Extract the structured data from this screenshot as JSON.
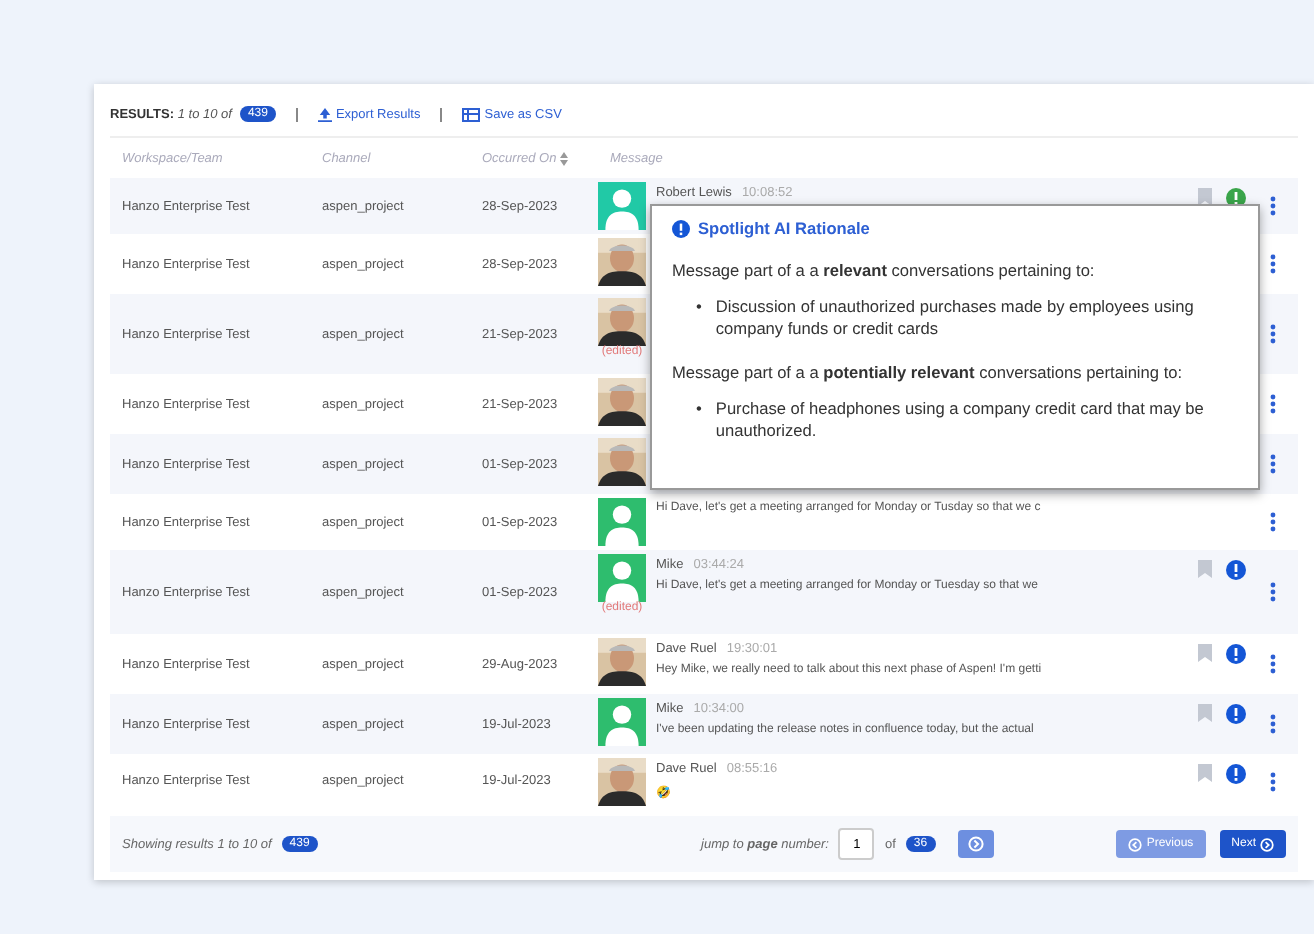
{
  "toolbar": {
    "results_label": "RESULTS:",
    "results_range": "1 to 10 of",
    "results_count": "439",
    "export": "Export Results",
    "csv": "Save as CSV"
  },
  "columns": [
    "Workspace/Team",
    "Channel",
    "Occurred On",
    "Message"
  ],
  "rows": [
    {
      "workspace": "Hanzo Enterprise Test",
      "channel": "aspen_project",
      "date": "28-Sep-2023",
      "avatar": {
        "kind": "person",
        "color": "#21c9a6"
      },
      "sender": "Robert Lewis",
      "time": "10:08:52",
      "bookmark": true,
      "flag": {
        "color": "#3aa54a"
      }
    },
    {
      "workspace": "Hanzo Enterprise Test",
      "channel": "aspen_project",
      "date": "28-Sep-2023"
    },
    {
      "workspace": "Hanzo Enterprise Test",
      "channel": "aspen_project",
      "date": "21-Sep-2023",
      "edited": "(edited)"
    },
    {
      "workspace": "Hanzo Enterprise Test",
      "channel": "aspen_project",
      "date": "21-Sep-2023"
    },
    {
      "workspace": "Hanzo Enterprise Test",
      "channel": "aspen_project",
      "date": "01-Sep-2023"
    },
    {
      "workspace": "Hanzo Enterprise Test",
      "channel": "aspen_project",
      "date": "01-Sep-2023",
      "avatar": {
        "kind": "person",
        "color": "#2ebd6e"
      },
      "text": "Hi Dave, let's get a meeting arranged for Monday or Tusday so that we c"
    },
    {
      "workspace": "Hanzo Enterprise Test",
      "channel": "aspen_project",
      "date": "01-Sep-2023",
      "avatar": {
        "kind": "person",
        "color": "#2ebd6e"
      },
      "sender": "Mike",
      "time": "03:44:24",
      "text": "Hi Dave, let's get a meeting arranged for Monday or Tuesday so that we",
      "edited": "(edited)",
      "bookmark": true,
      "flag": {
        "color": "#1456d6"
      }
    },
    {
      "workspace": "Hanzo Enterprise Test",
      "channel": "aspen_project",
      "date": "29-Aug-2023",
      "sender": "Dave Ruel",
      "time": "19:30:01",
      "text": "Hey Mike, we really need to talk about this next phase of Aspen! I'm getti",
      "bookmark": true,
      "flag": {
        "color": "#1456d6"
      }
    },
    {
      "workspace": "Hanzo Enterprise Test",
      "channel": "aspen_project",
      "date": "19-Jul-2023",
      "avatar": {
        "kind": "person",
        "color": "#2ebd6e"
      },
      "sender": "Mike",
      "time": "10:34:00",
      "text": "I've been updating the release notes in confluence today, but the actual",
      "bookmark": true,
      "flag": {
        "color": "#1456d6"
      }
    },
    {
      "workspace": "Hanzo Enterprise Test",
      "channel": "aspen_project",
      "date": "19-Jul-2023",
      "sender": "Dave Ruel",
      "time": "08:55:16",
      "text": "🤣",
      "bookmark": true,
      "flag": {
        "color": "#1456d6"
      }
    }
  ],
  "popup": {
    "title": "Spotlight AI Rationale",
    "marker": "•",
    "sections": [
      {
        "text": "Message part of a a **relevant** conversations pertaining to:",
        "bullets": [
          "Discussion of unauthorized purchases made by employees using company funds or credit cards"
        ]
      },
      {
        "text": "Message part of a a **potentially relevant** conversations pertaining to:",
        "bullets": [
          "Purchase of headphones using a company credit card that may be unauthorized."
        ]
      }
    ]
  },
  "footer": {
    "showing": "Showing results 1 to 10 of",
    "count": "439",
    "jump": "jump to **page** number:",
    "page": "1",
    "of": "of",
    "pages": "36",
    "previous": {
      "label": "Previous",
      "disabled": true
    },
    "next": {
      "label": "Next",
      "disabled": false
    }
  }
}
